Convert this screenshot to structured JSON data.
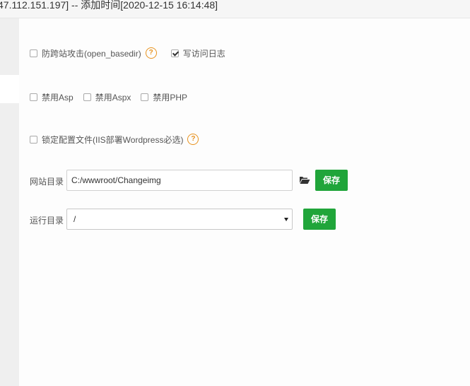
{
  "window": {
    "title": "47.112.151.197] -- 添加时间[2020-12-15 16:14:48]"
  },
  "options": {
    "open_basedir": {
      "label": "防跨站攻击(open_basedir)",
      "checked": false
    },
    "access_log": {
      "label": "写访问日志",
      "checked": true
    },
    "disable_asp": {
      "label": "禁用Asp",
      "checked": false
    },
    "disable_aspx": {
      "label": "禁用Aspx",
      "checked": false
    },
    "disable_php": {
      "label": "禁用PHP",
      "checked": false
    },
    "lock_config": {
      "label": "锁定配置文件(IIS部署Wordpress必选)",
      "checked": false
    }
  },
  "help_icon_glyph": "?",
  "site_dir": {
    "label": "网站目录",
    "value": "C:/wwwroot/Changeimg",
    "save_label": "保存"
  },
  "run_dir": {
    "label": "运行目录",
    "value": "/",
    "save_label": "保存"
  },
  "colors": {
    "accent_green": "#20a53a",
    "help_orange": "#e8921e"
  },
  "icons": {
    "browse": "folder-open-icon",
    "help": "question-circle-icon",
    "dropdown": "caret-down-icon"
  }
}
